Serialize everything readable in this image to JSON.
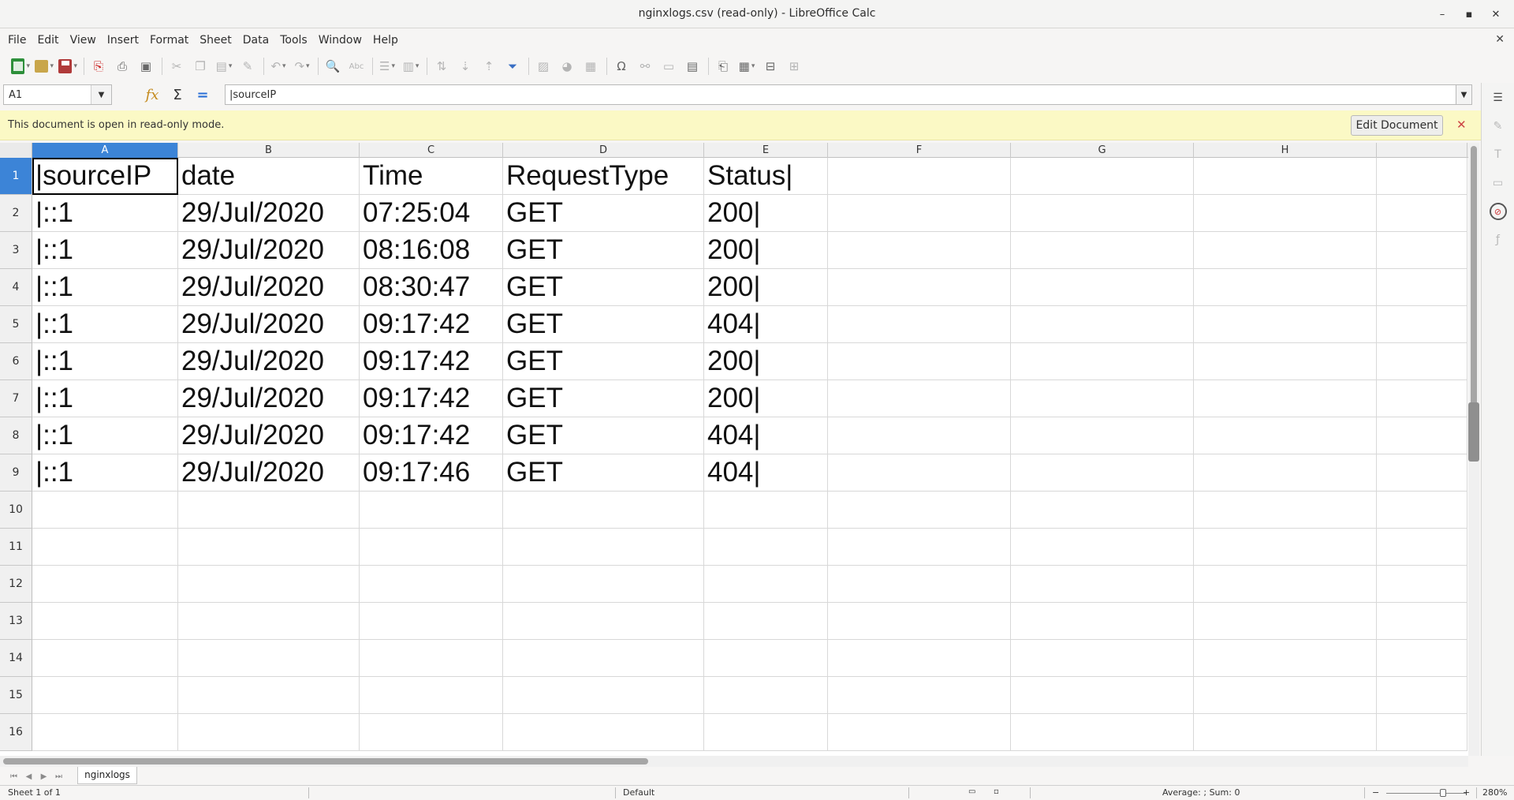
{
  "window": {
    "title": "nginxlogs.csv (read-only) - LibreOffice Calc",
    "minimize": "–",
    "maximize": "▪",
    "close": "✕"
  },
  "menu": [
    "File",
    "Edit",
    "View",
    "Insert",
    "Format",
    "Sheet",
    "Data",
    "Tools",
    "Window",
    "Help"
  ],
  "menu_close": "✕",
  "formula_bar": {
    "cell_ref": "A1",
    "content": "|sourceIP",
    "sigma": "Σ",
    "equals": "=",
    "wizard": "fx"
  },
  "infobar": {
    "message": "This document is open in read-only mode.",
    "button": "Edit Document",
    "close": "✕"
  },
  "sheet": {
    "columns": [
      "A",
      "B",
      "C",
      "D",
      "E",
      "F",
      "G",
      "H"
    ],
    "rows": [
      "1",
      "2",
      "3",
      "4",
      "5",
      "6",
      "7",
      "8",
      "9",
      "10",
      "11",
      "12",
      "13",
      "14",
      "15",
      "16"
    ],
    "active_cell": "A1",
    "data": [
      [
        "|sourceIP",
        "date",
        "Time",
        "RequestType",
        "Status|"
      ],
      [
        "|::1",
        "29/Jul/2020",
        "07:25:04",
        "GET",
        "200|"
      ],
      [
        "|::1",
        "29/Jul/2020",
        "08:16:08",
        "GET",
        "200|"
      ],
      [
        "|::1",
        "29/Jul/2020",
        "08:30:47",
        "GET",
        "200|"
      ],
      [
        "|::1",
        "29/Jul/2020",
        "09:17:42",
        "GET",
        "404|"
      ],
      [
        "|::1",
        "29/Jul/2020",
        "09:17:42",
        "GET",
        "200|"
      ],
      [
        "|::1",
        "29/Jul/2020",
        "09:17:42",
        "GET",
        "200|"
      ],
      [
        "|::1",
        "29/Jul/2020",
        "09:17:42",
        "GET",
        "404|"
      ],
      [
        "|::1",
        "29/Jul/2020",
        "09:17:46",
        "GET",
        "404|"
      ]
    ]
  },
  "tabs": {
    "sheet_name": "nginxlogs",
    "nav": [
      "⏮",
      "◀",
      "▶",
      "⏭"
    ]
  },
  "status": {
    "sheet_info": "Sheet 1 of 1",
    "page_style": "Default",
    "summary": "Average: ; Sum: 0",
    "zoom": "280%",
    "zoom_out": "−",
    "zoom_in": "+"
  },
  "colors": {
    "selection": "#3c84d7",
    "infobar": "#fbf9c5"
  }
}
